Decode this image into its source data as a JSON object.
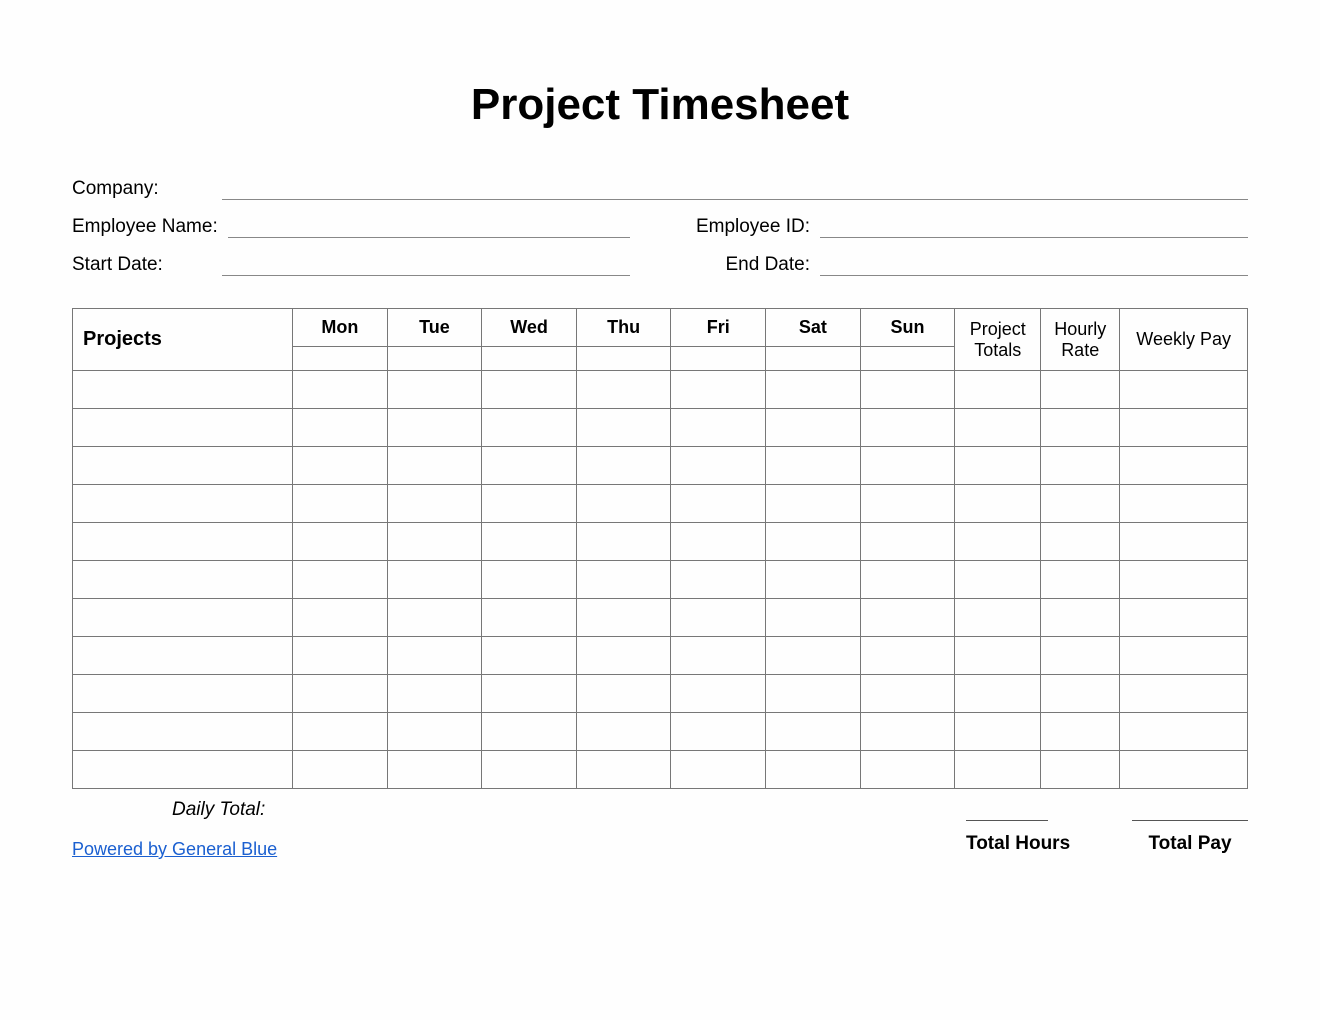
{
  "title": "Project Timesheet",
  "meta": {
    "company_label": "Company:",
    "company_value": "",
    "employee_name_label": "Employee Name:",
    "employee_name_value": "",
    "employee_id_label": "Employee ID:",
    "employee_id_value": "",
    "start_date_label": "Start Date:",
    "start_date_value": "",
    "end_date_label": "End Date:",
    "end_date_value": ""
  },
  "table": {
    "projects_header": "Projects",
    "days": [
      "Mon",
      "Tue",
      "Wed",
      "Thu",
      "Fri",
      "Sat",
      "Sun"
    ],
    "project_totals_header": "Project Totals",
    "hourly_rate_header": "Hourly Rate",
    "weekly_pay_header": "Weekly Pay",
    "data_row_count": 11
  },
  "footer": {
    "daily_total_label": "Daily Total:",
    "total_hours_label": "Total Hours",
    "total_hours_value": "",
    "total_pay_label": "Total Pay",
    "total_pay_value": "",
    "powered_text": "Powered by General Blue"
  }
}
